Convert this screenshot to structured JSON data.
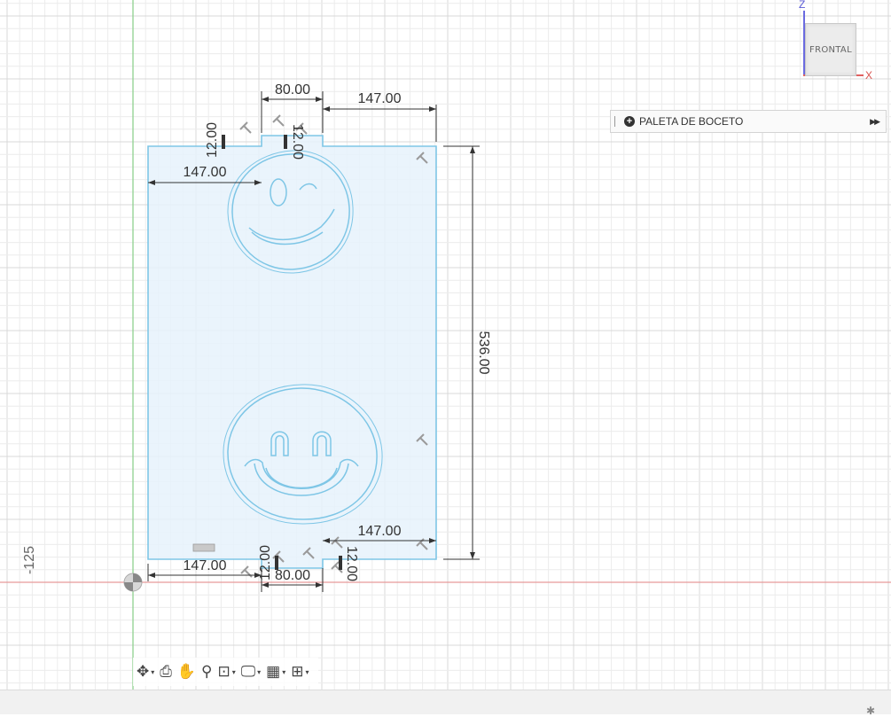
{
  "viewcube": {
    "face_label": "FRONTAL",
    "z_axis": "Z",
    "x_axis": "X"
  },
  "palette": {
    "title": "PALETA DE BOCETO",
    "expand_icon": "double-chevron-right-icon"
  },
  "sketch": {
    "dimensions": {
      "top_notch_width": "80.00",
      "top_right_offset": "147.00",
      "top_left_offset": "147.00",
      "top_left_notch_depth": "12.00",
      "top_right_notch_depth": "12.00",
      "overall_height": "536.00",
      "bottom_right_offset": "147.00",
      "bottom_left_offset": "147.00",
      "bottom_notch_width": "80.00",
      "bottom_left_notch_depth": "12.00",
      "bottom_right_notch_depth": "12.00"
    },
    "axis_label": "-125",
    "fill_color": "#e3f1fb",
    "stroke_color": "#7ec6e6"
  },
  "navbar": {
    "items": [
      {
        "name": "orbit-icon",
        "glyph": "✥",
        "caret": "▾"
      },
      {
        "name": "look-at-icon",
        "glyph": "⎙",
        "caret": ""
      },
      {
        "name": "pan-hand-icon",
        "glyph": "✋",
        "caret": ""
      },
      {
        "name": "zoom-icon",
        "glyph": "⚲",
        "caret": ""
      },
      {
        "name": "zoom-window-icon",
        "glyph": "⊡",
        "caret": "▾"
      },
      {
        "name": "display-settings-icon",
        "glyph": "🖵",
        "caret": "▾"
      },
      {
        "name": "grid-settings-icon",
        "glyph": "▦",
        "caret": "▾"
      },
      {
        "name": "viewports-icon",
        "glyph": "⊞",
        "caret": "▾"
      }
    ]
  },
  "statusbar": {
    "settings_icon": "gear-icon"
  }
}
